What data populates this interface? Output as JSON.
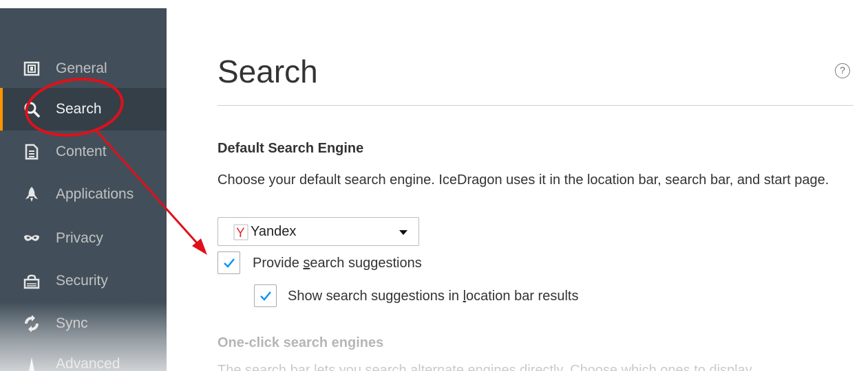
{
  "sidebar": {
    "items": [
      {
        "label": "General",
        "icon": "general-icon"
      },
      {
        "label": "Search",
        "icon": "search-icon",
        "selected": true
      },
      {
        "label": "Content",
        "icon": "content-icon"
      },
      {
        "label": "Applications",
        "icon": "applications-icon"
      },
      {
        "label": "Privacy",
        "icon": "privacy-icon"
      },
      {
        "label": "Security",
        "icon": "security-icon"
      },
      {
        "label": "Sync",
        "icon": "sync-icon"
      },
      {
        "label": "Advanced",
        "icon": "advanced-icon"
      }
    ]
  },
  "main": {
    "title": "Search",
    "help_icon": "?",
    "default_engine": {
      "heading": "Default Search Engine",
      "description": "Choose your default search engine. IceDragon uses it in the location bar, search bar, and start page.",
      "selected_engine": "Yandex",
      "provide_suggestions": {
        "checked": true,
        "label_pre": "Provide ",
        "label_access": "s",
        "label_post": "earch suggestions"
      },
      "location_bar_suggestions": {
        "checked": true,
        "label_pre": "Show search suggestions in ",
        "label_access": "l",
        "label_post": "ocation bar results"
      }
    },
    "one_click": {
      "heading": "One-click search engines",
      "description": "The search bar lets you search alternate engines directly. Choose which ones to display"
    }
  },
  "colors": {
    "sidebar_bg": "#424f5a",
    "sidebar_selected_bg": "#343f48",
    "selected_accent": "#ff9500",
    "checkmark": "#0996f8",
    "annotation_red": "#e0101a"
  }
}
